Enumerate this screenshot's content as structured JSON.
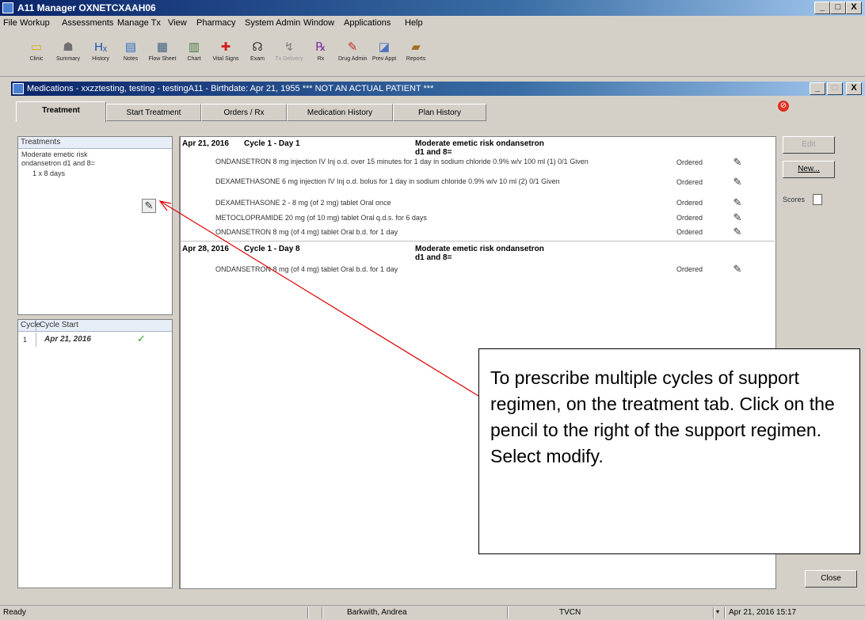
{
  "window": {
    "title": "A11 Manager OXNETCXAAH06",
    "buttons": [
      "_",
      "□",
      "X"
    ]
  },
  "menu": [
    "File",
    "Workup",
    "Assessments",
    "Manage Tx",
    "View",
    "Pharmacy",
    "System Admin",
    "Window",
    "Applications",
    "Help"
  ],
  "toolbar": [
    {
      "label": "Clinic",
      "icon": "folder-icon"
    },
    {
      "label": "Summary",
      "icon": "summary-icon"
    },
    {
      "label": "History",
      "icon": "history-icon"
    },
    {
      "label": "Notes",
      "icon": "notes-icon"
    },
    {
      "label": "Flow Sheet",
      "icon": "flow-sheet-icon"
    },
    {
      "label": "Chart",
      "icon": "chart-icon"
    },
    {
      "label": "Vital Signs",
      "icon": "vital-signs-icon"
    },
    {
      "label": "Exam",
      "icon": "exam-icon"
    },
    {
      "label": "Tx Delivery",
      "icon": "tx-delivery-icon"
    },
    {
      "label": "Rx",
      "icon": "rx-icon"
    },
    {
      "label": "Drug Admin",
      "icon": "drug-admin-icon"
    },
    {
      "label": "Prev Appt",
      "icon": "prev-appt-icon"
    },
    {
      "label": "Reports",
      "icon": "reports-icon"
    }
  ],
  "child_window": {
    "title": "Medications - xxzztesting, testing - testingA11 - Birthdate: Apr 21, 1955 *** NOT AN ACTUAL PATIENT ***"
  },
  "tabs": [
    "Treatment",
    "Start Treatment",
    "Orders / Rx",
    "Medication History",
    "Plan History"
  ],
  "treatments": {
    "header": "Treatments",
    "item_name": "Moderate emetic risk ondansetron d1 and 8=",
    "item_duration": "1 x 8 days"
  },
  "cycles": {
    "headers": [
      "Cycle",
      "Cycle Start"
    ],
    "rows": [
      {
        "num": "1",
        "start": "Apr 21, 2016"
      }
    ]
  },
  "orders": [
    {
      "date": "Apr 21, 2016",
      "cycle": "Cycle 1 - Day 1",
      "regimen": "Moderate emetic risk ondansetron d1 and 8=",
      "drugs": [
        {
          "text": "ONDANSETRON 8 mg injection IV Inj o.d. over 15 minutes for 1 day in sodium chloride 0.9% w/v 100 ml (1)  0/1 Given",
          "status": "Ordered"
        },
        {
          "text": "DEXAMETHASONE 6 mg injection IV Inj o.d. bolus for 1 day in sodium chloride 0.9% w/v 10 ml (2)  0/1 Given",
          "status": "Ordered"
        },
        {
          "text": "DEXAMETHASONE 2 - 8 mg (of 2 mg) tablet Oral once",
          "status": "Ordered"
        },
        {
          "text": "METOCLOPRAMIDE 20 mg (of 10 mg) tablet Oral q.d.s. for 6 days",
          "status": "Ordered"
        },
        {
          "text": "ONDANSETRON 8 mg (of 4 mg) tablet Oral b.d. for 1 day",
          "status": "Ordered"
        }
      ]
    },
    {
      "date": "Apr 28, 2016",
      "cycle": "Cycle 1 - Day 8",
      "regimen": "Moderate emetic risk ondansetron d1 and 8=",
      "drugs": [
        {
          "text": "ONDANSETRON 8 mg (of 4 mg) tablet Oral b.d. for 1 day",
          "status": "Ordered"
        }
      ]
    }
  ],
  "side": {
    "edit_label": "Edit",
    "new_label": "New...",
    "scores_label": "Scores",
    "close_label": "Close"
  },
  "statusbar": {
    "ready": "Ready",
    "user": "Barkwith, Andrea",
    "site": "TVCN",
    "datetime": "Apr 21, 2016 15:17"
  },
  "callout_text": "To prescribe multiple cycles of support regimen, on the treatment tab. Click on the pencil to the right of the support regimen.\nSelect modify."
}
